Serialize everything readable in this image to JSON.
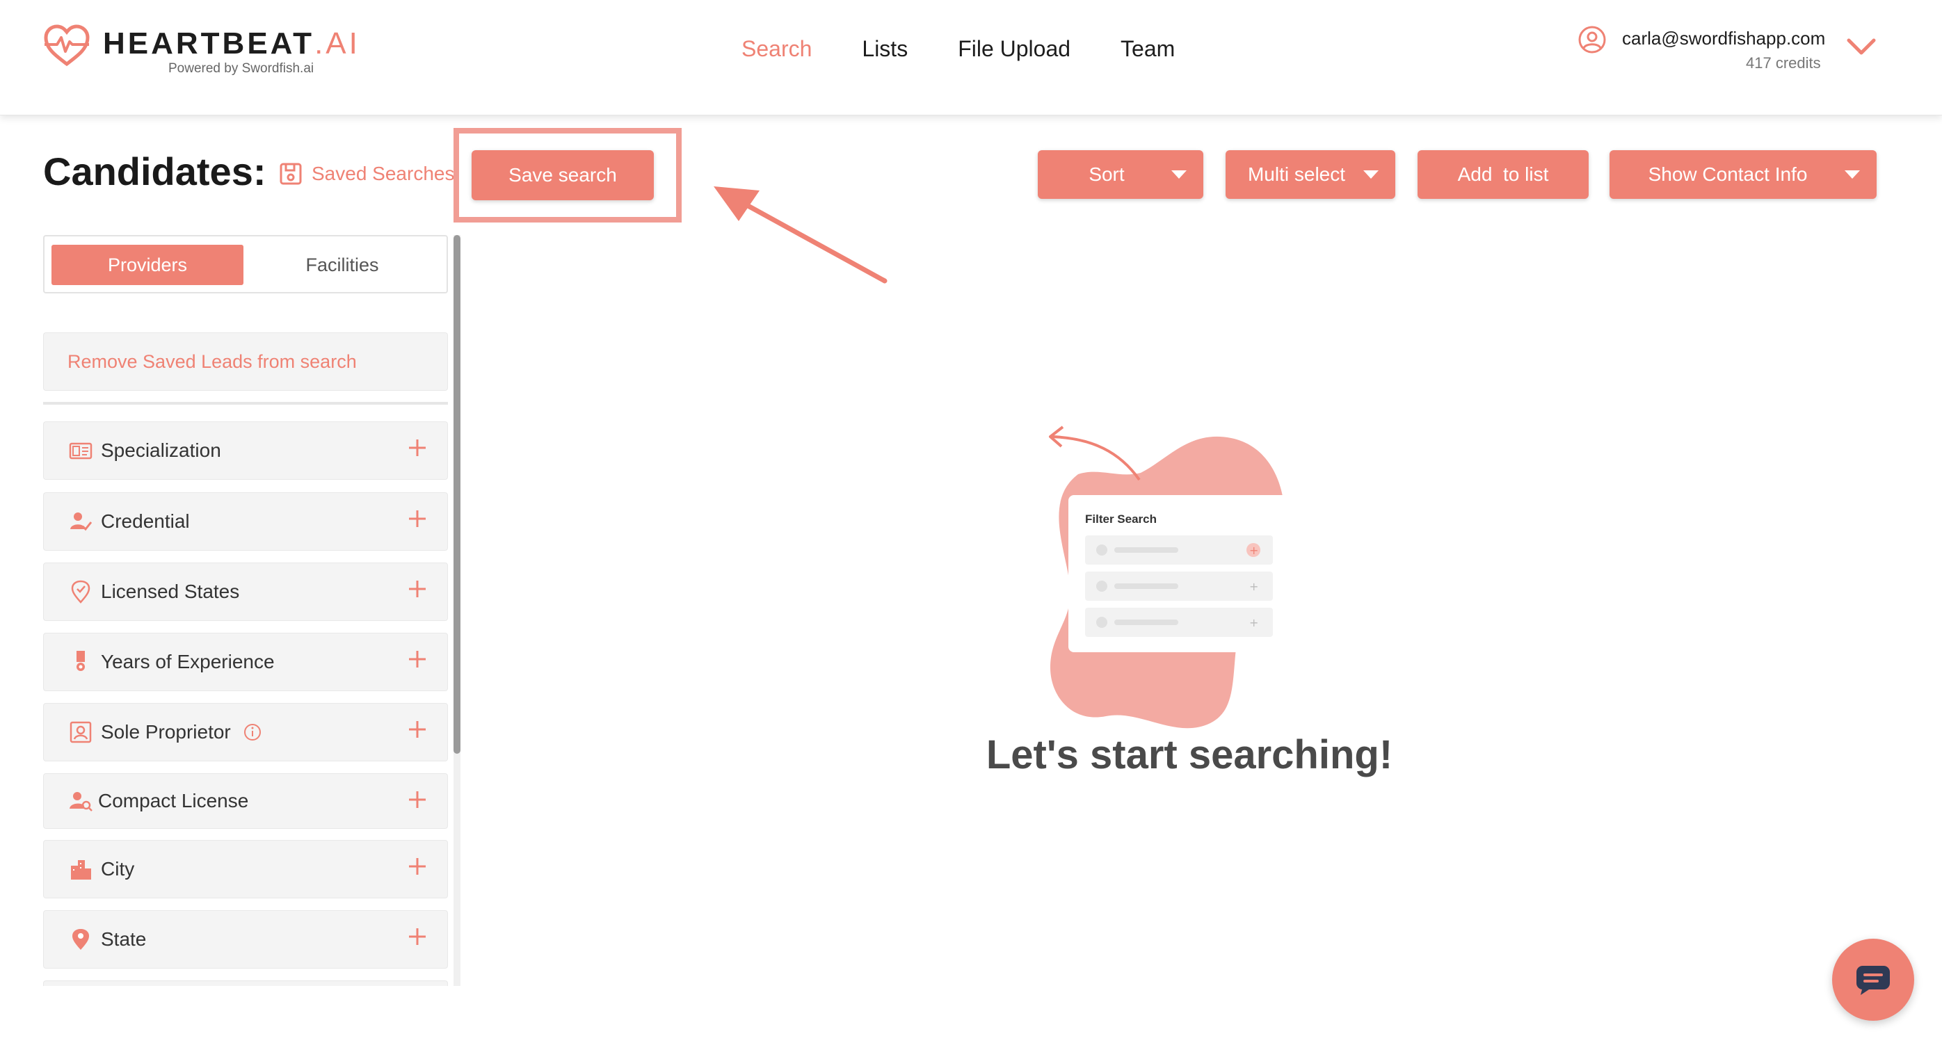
{
  "header": {
    "brand_main": "HEARTBEAT",
    "brand_ai": ".AI",
    "powered_by": "Powered by Swordfish.ai",
    "nav": [
      "Search",
      "Lists",
      "File Upload",
      "Team"
    ],
    "active_nav": "Search",
    "account_email": "carla@swordfishapp.com",
    "credits": "417 credits"
  },
  "toolbar": {
    "title": "Candidates:",
    "saved_searches": "Saved Searches",
    "save_search": "Save search",
    "sort": "Sort",
    "multi_select": "Multi select",
    "add_to_list": "Add  to list",
    "show_contact_info": "Show Contact Info"
  },
  "sidebar": {
    "tabs": [
      "Providers",
      "Facilities"
    ],
    "active_tab": "Providers",
    "remove_saved_leads": "Remove Saved Leads from search",
    "filters": [
      {
        "label": "Specialization",
        "icon": "id-card-icon"
      },
      {
        "label": "Credential",
        "icon": "user-check-icon"
      },
      {
        "label": "Licensed States",
        "icon": "location-check-icon"
      },
      {
        "label": "Years of Experience",
        "icon": "medal-icon"
      },
      {
        "label": "Sole Proprietor",
        "icon": "portrait-icon"
      },
      {
        "label": "Compact License",
        "icon": "user-search-icon"
      },
      {
        "label": "City",
        "icon": "buildings-icon"
      },
      {
        "label": "State",
        "icon": "map-pin-icon"
      }
    ]
  },
  "empty_state": {
    "card_title": "Filter Search",
    "message": "Let's start searching!"
  },
  "colors": {
    "accent": "#ef8274",
    "accent_light": "#f3aaa2",
    "highlight_border": "#f19d94",
    "text_dark": "#1d1d1d"
  }
}
